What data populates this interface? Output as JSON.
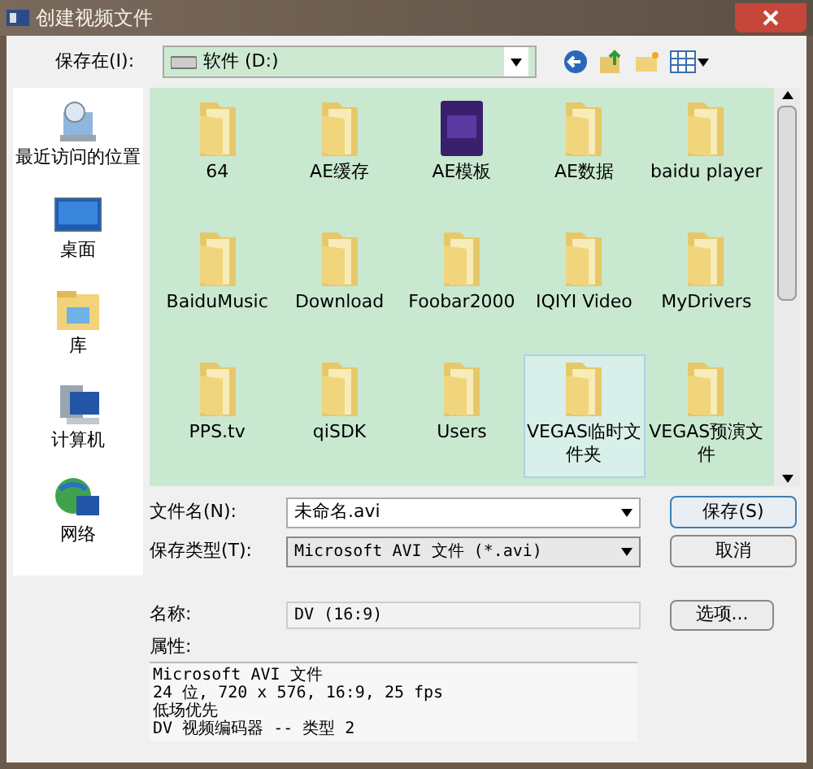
{
  "window": {
    "title": "创建视频文件"
  },
  "save_in": {
    "label": "保存在(I):",
    "value": "软件 (D:)"
  },
  "places": [
    {
      "label": "最近访问的位置",
      "kind": "recent"
    },
    {
      "label": "桌面",
      "kind": "desktop"
    },
    {
      "label": "库",
      "kind": "library"
    },
    {
      "label": "计算机",
      "kind": "computer"
    },
    {
      "label": "网络",
      "kind": "network"
    }
  ],
  "files": [
    {
      "name": "64",
      "kind": "folder",
      "selected": false
    },
    {
      "name": "AE缓存",
      "kind": "folder",
      "selected": false
    },
    {
      "name": "AE模板",
      "kind": "app",
      "selected": false
    },
    {
      "name": "AE数据",
      "kind": "folder",
      "selected": false
    },
    {
      "name": "baidu player",
      "kind": "folder",
      "selected": false
    },
    {
      "name": "BaiduMusic",
      "kind": "folder",
      "selected": false
    },
    {
      "name": "Download",
      "kind": "folder",
      "selected": false
    },
    {
      "name": "Foobar2000",
      "kind": "folder",
      "selected": false
    },
    {
      "name": "IQIYI Video",
      "kind": "folder",
      "selected": false
    },
    {
      "name": "MyDrivers",
      "kind": "folder",
      "selected": false
    },
    {
      "name": "PPS.tv",
      "kind": "folder",
      "selected": false
    },
    {
      "name": "qiSDK",
      "kind": "folder",
      "selected": false
    },
    {
      "name": "Users",
      "kind": "folder",
      "selected": false
    },
    {
      "name": "VEGAS临时文件夹",
      "kind": "folder",
      "selected": true
    },
    {
      "name": "VEGAS预演文件",
      "kind": "folder",
      "selected": false
    }
  ],
  "file_name": {
    "label": "文件名(N):",
    "value": "未命名.avi"
  },
  "file_type": {
    "label": "保存类型(T):",
    "value": "Microsoft AVI 文件 (*.avi)"
  },
  "buttons": {
    "save": "保存(S)",
    "cancel": "取消",
    "options": "选项..."
  },
  "template_name": {
    "label": "名称:",
    "value": "DV (16:9)"
  },
  "attributes": {
    "label": "属性:",
    "lines": [
      "Microsoft AVI 文件",
      "24 位, 720 x 576, 16:9, 25 fps",
      "低场优先",
      "DV 视频编码器 -- 类型 2"
    ]
  }
}
